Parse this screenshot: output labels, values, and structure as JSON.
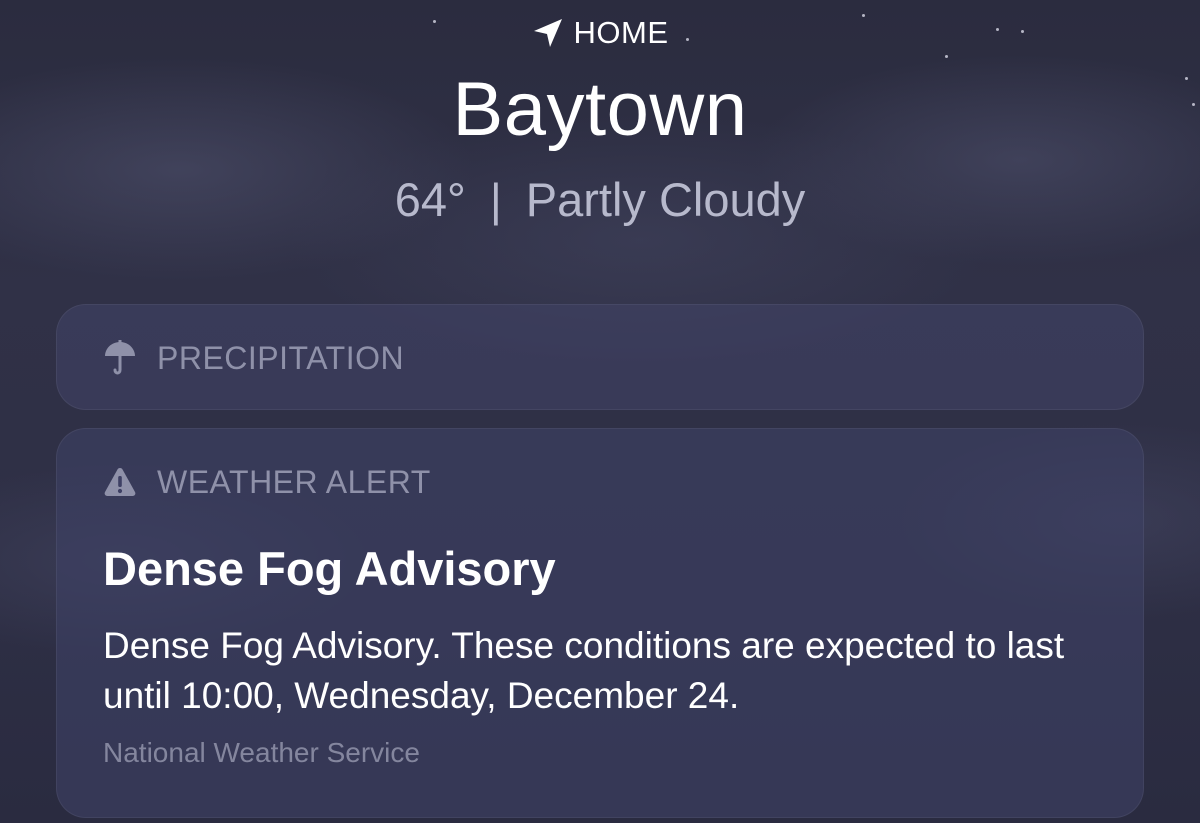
{
  "header": {
    "location_label": "HOME",
    "city": "Baytown",
    "temperature": "64°",
    "separator": "|",
    "condition": "Partly Cloudy"
  },
  "precipitation_card": {
    "icon": "umbrella-icon",
    "label": "PRECIPITATION"
  },
  "alert_card": {
    "icon": "warning-triangle-icon",
    "label": "WEATHER ALERT",
    "title": "Dense Fog Advisory",
    "description": "Dense Fog Advisory. These conditions are expected to last until 10:00, Wednesday, December 24.",
    "source": "National Weather Service"
  },
  "colors": {
    "background": "#2e2f45",
    "card": "#424468",
    "muted_label": "#8f91a9",
    "secondary_text": "#b7b9cc"
  }
}
